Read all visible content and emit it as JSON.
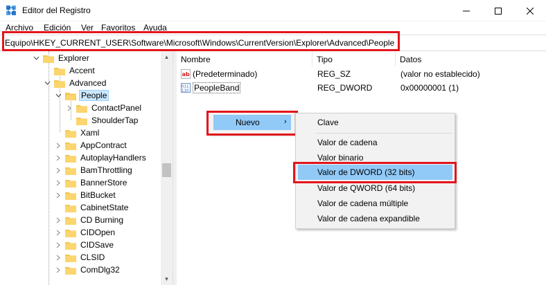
{
  "window": {
    "title": "Editor del Registro",
    "icon": "regedit-icon",
    "controls": [
      "minimize-icon",
      "maximize-icon",
      "close-icon"
    ]
  },
  "menu": [
    "Archivo",
    "Edición",
    "Ver",
    "Favoritos",
    "Ayuda"
  ],
  "address": "Equipo\\HKEY_CURRENT_USER\\Software\\Microsoft\\Windows\\CurrentVersion\\Explorer\\Advanced\\People",
  "tree": {
    "items": [
      {
        "label": "Explorer"
      },
      {
        "label": "Accent"
      },
      {
        "label": "Advanced"
      },
      {
        "label": "People"
      },
      {
        "label": "ContactPanel"
      },
      {
        "label": "ShoulderTap"
      },
      {
        "label": "Xaml"
      },
      {
        "label": "AppContract"
      },
      {
        "label": "AutoplayHandlers"
      },
      {
        "label": "BamThrottling"
      },
      {
        "label": "BannerStore"
      },
      {
        "label": "BitBucket"
      },
      {
        "label": "CabinetState"
      },
      {
        "label": "CD Burning"
      },
      {
        "label": "CIDOpen"
      },
      {
        "label": "CIDSave"
      },
      {
        "label": "CLSID"
      },
      {
        "label": "ComDlg32"
      }
    ]
  },
  "list": {
    "columns": [
      "Nombre",
      "Tipo",
      "Datos"
    ],
    "rows": [
      {
        "name": "(Predeterminado)",
        "type": "REG_SZ",
        "data": "(valor no establecido)",
        "icon": "string-value-icon"
      },
      {
        "name": "PeopleBand",
        "type": "REG_DWORD",
        "data": "0x00000001 (1)",
        "icon": "binary-value-icon"
      }
    ]
  },
  "context_menu": {
    "new_label": "Nuevo",
    "submenu": [
      "Clave",
      "Valor de cadena",
      "Valor binario",
      "Valor de DWORD (32 bits)",
      "Valor de QWORD (64 bits)",
      "Valor de cadena múltiple",
      "Valor de cadena expandible"
    ]
  },
  "colors": {
    "highlight_annotation": "#e3141c",
    "menu_hover": "#91c9f7",
    "folder": "#f5c651",
    "selection": "#cce8ff"
  }
}
